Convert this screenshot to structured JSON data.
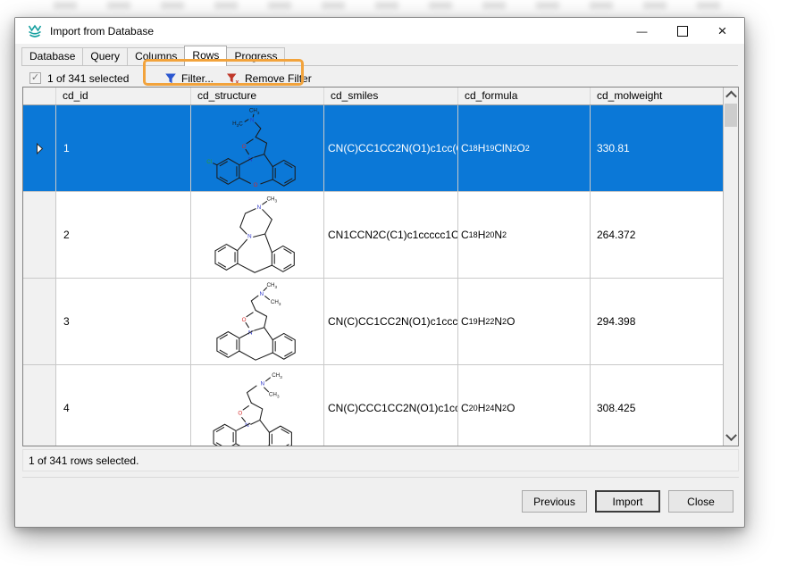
{
  "window": {
    "title": "Import from Database",
    "app_icon": "database-wave-logo"
  },
  "icons": {
    "checkbox_check": "✓",
    "minimize": "—",
    "maximize": "window-maximize-square",
    "close": "×",
    "filter": "blue-funnel-icon",
    "remove_filter": "red-funnel-x-icon",
    "row_marker": "current-row-arrow",
    "scroll_up": "chevron-up",
    "scroll_down": "chevron-down"
  },
  "tabs": [
    {
      "label": "Database",
      "active": false
    },
    {
      "label": "Query",
      "active": false
    },
    {
      "label": "Columns",
      "active": false
    },
    {
      "label": "Rows",
      "active": true
    },
    {
      "label": "Progress",
      "active": false
    }
  ],
  "toolbar": {
    "selection_checkbox": {
      "checked": true,
      "disabled": true,
      "label": "1 of 341 selected"
    },
    "filter_button_label": "Filter...",
    "remove_filter_button_label": "Remove Filter",
    "annotation": {
      "shape": "orange-highlight-box",
      "color": "#F2A33C"
    }
  },
  "table": {
    "columns": [
      "cd_id",
      "cd_structure",
      "cd_smiles",
      "cd_formula",
      "cd_molweight"
    ],
    "rows": [
      {
        "cd_id": "1",
        "structure_alt": "chloro-dibenzoxazepine fused isoxazolidine with CH2-N(CH3)2 group",
        "cd_smiles": "CN(C)CC1CC2N(O1)c1cc(C…",
        "cd_formula": [
          [
            "C",
            "18"
          ],
          [
            "H",
            "19"
          ],
          [
            "ClN",
            "2"
          ],
          [
            "O",
            "2"
          ]
        ],
        "cd_molweight": "330.81",
        "selected": true
      },
      {
        "cd_id": "2",
        "structure_alt": "tetracyclic dibenzazepine fused N-methylpiperazine (mianserin-like)",
        "cd_smiles": "CN1CCN2C(C1)c1ccccc1Cc…",
        "cd_formula": [
          [
            "C",
            "18"
          ],
          [
            "H",
            "20"
          ],
          [
            "N",
            "2"
          ]
        ],
        "cd_molweight": "264.372",
        "selected": false
      },
      {
        "cd_id": "3",
        "structure_alt": "dibenzazepine fused isoxazolidine with CH2-N(CH3)2 group",
        "cd_smiles": "CN(C)CC1CC2N(O1)c1cccc…",
        "cd_formula": [
          [
            "C",
            "19"
          ],
          [
            "H",
            "22"
          ],
          [
            "N",
            "2"
          ],
          [
            "O",
            ""
          ]
        ],
        "cd_molweight": "294.398",
        "selected": false
      },
      {
        "cd_id": "4",
        "structure_alt": "dibenzazepine fused isoxazolidine with CH2CH2-N(CH3)2 group",
        "cd_smiles": "CN(C)CCC1CC2N(O1)c1cc…",
        "cd_formula": [
          [
            "C",
            "20"
          ],
          [
            "H",
            "24"
          ],
          [
            "N",
            "2"
          ],
          [
            "O",
            ""
          ]
        ],
        "cd_molweight": "308.425",
        "selected": false
      }
    ]
  },
  "status_bar": {
    "text": "1 of 341 rows selected."
  },
  "footer_buttons": [
    {
      "label": "Previous",
      "default": false
    },
    {
      "label": "Import",
      "default": true
    },
    {
      "label": "Close",
      "default": false
    }
  ],
  "colors": {
    "selection_blue": "#0B78D7",
    "annotation_orange": "#F2A33C",
    "filter_icon_blue": "#2B57D0",
    "remove_filter_red": "#C0392B",
    "app_icon_teal": "#17A0A0"
  }
}
